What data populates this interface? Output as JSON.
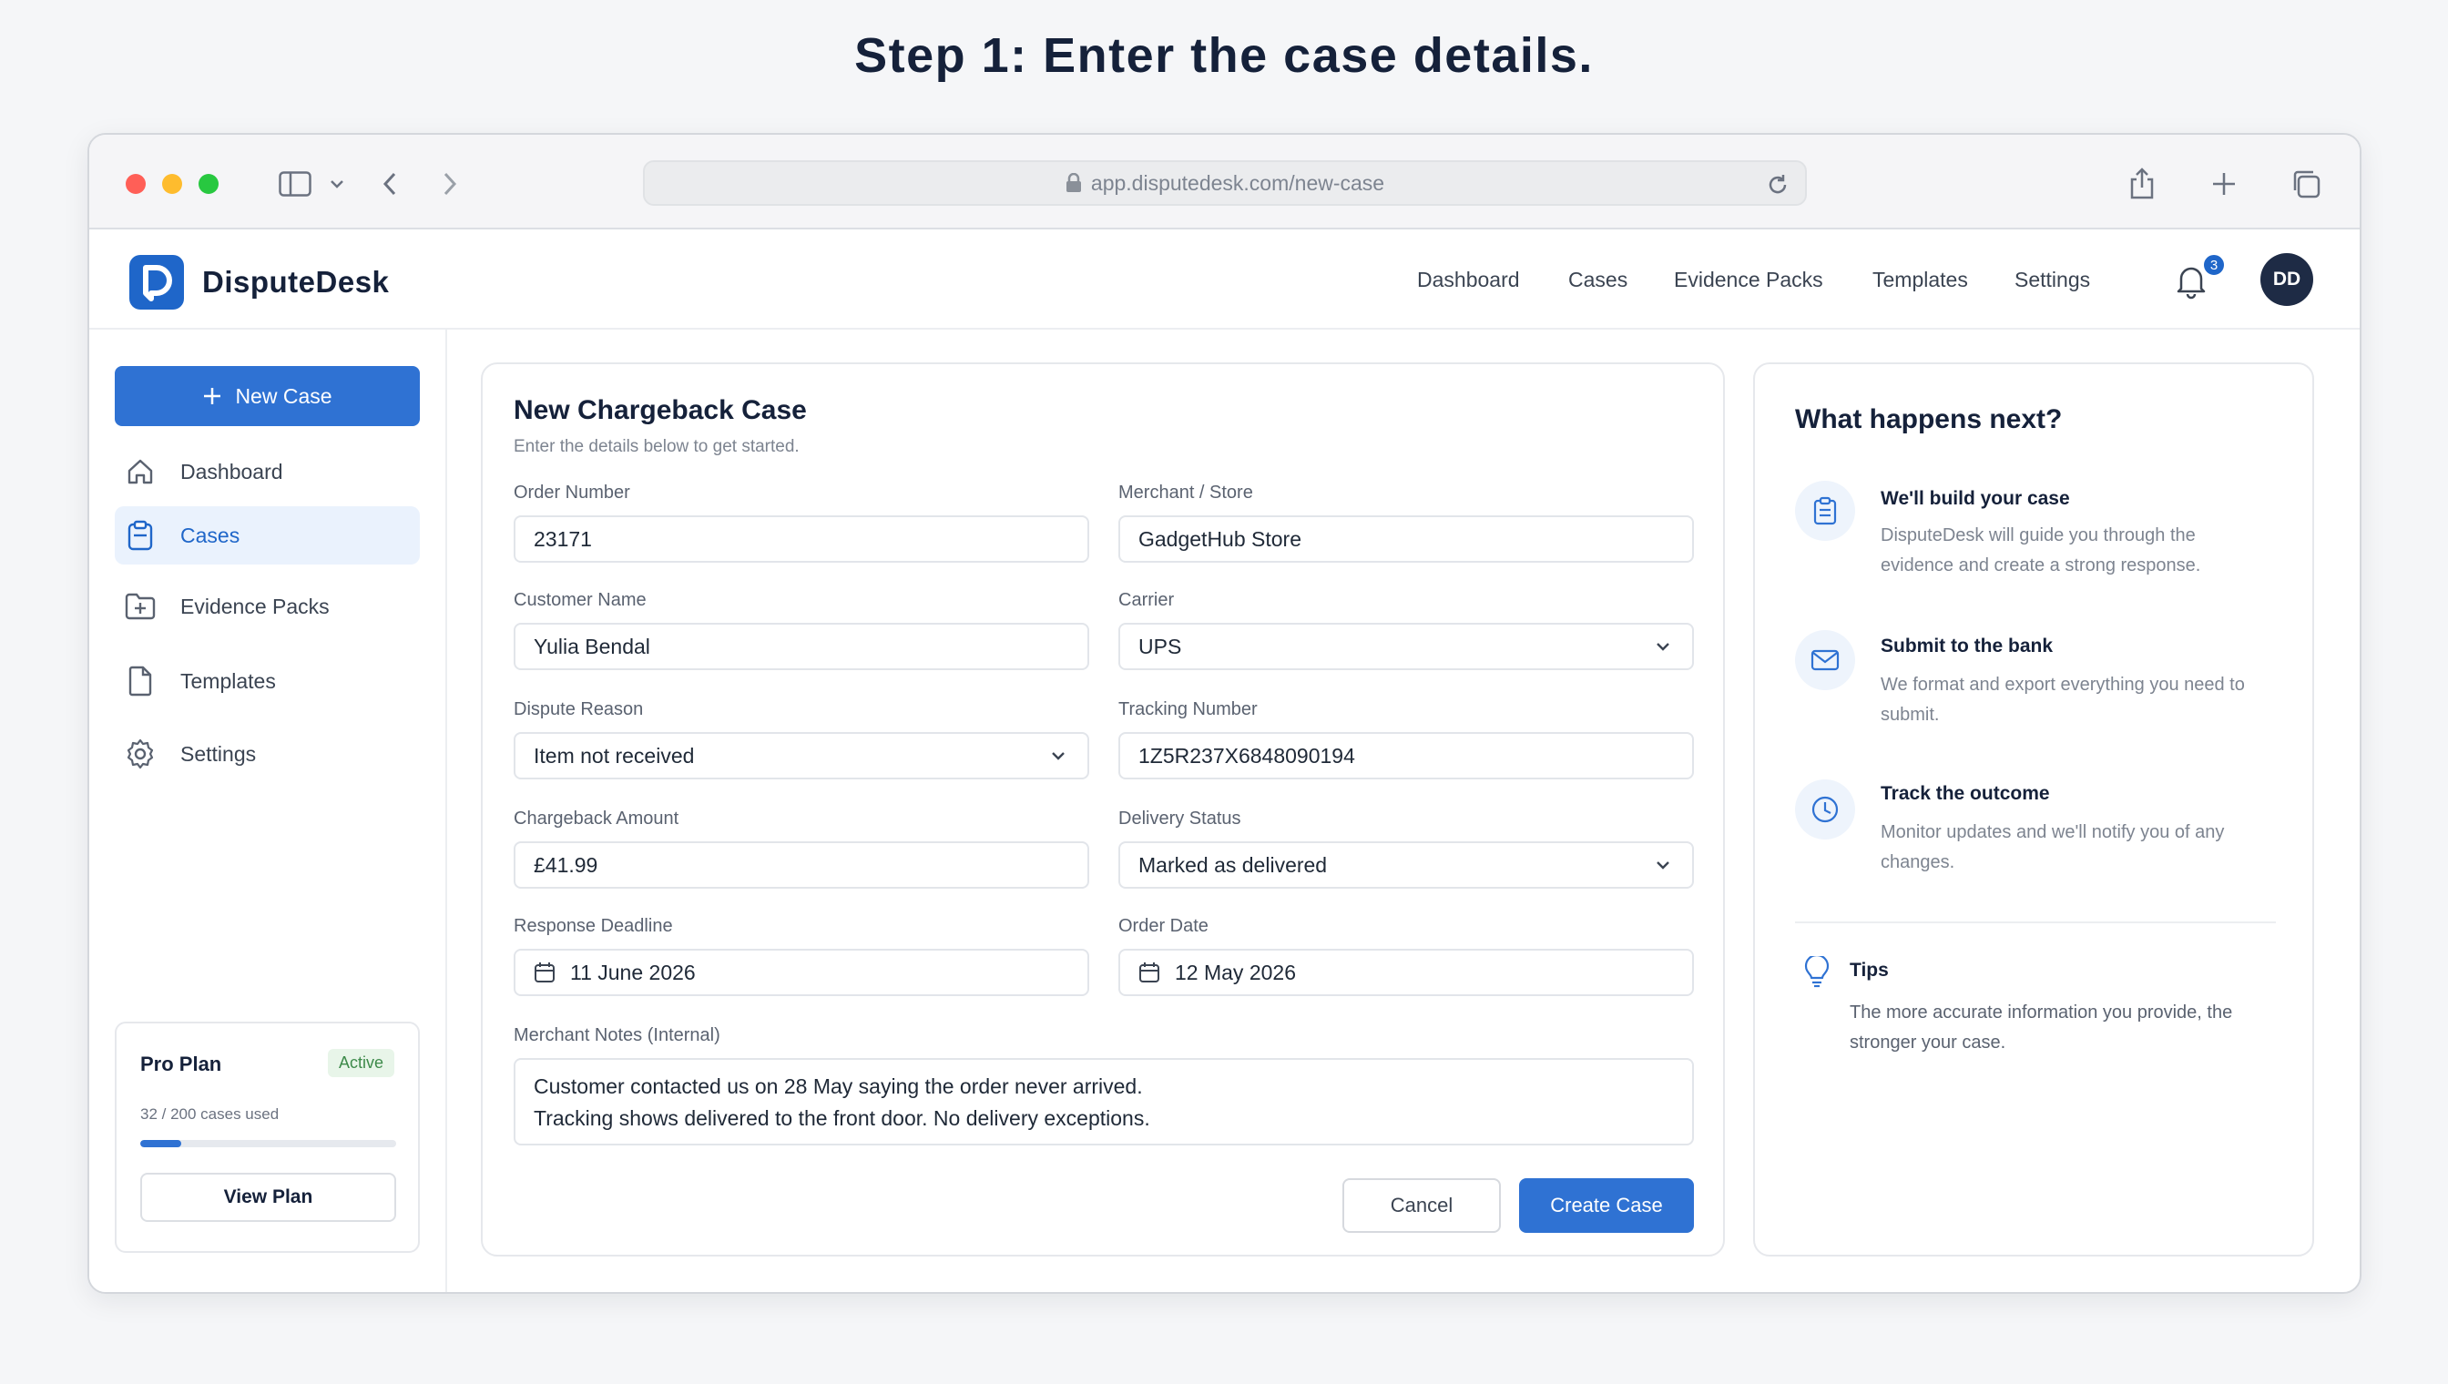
{
  "page": {
    "step_title": "Step 1: Enter the case details."
  },
  "browser": {
    "url": "app.disputedesk.com/new-case"
  },
  "app": {
    "name": "DisputeDesk"
  },
  "header": {
    "nav": [
      "Dashboard",
      "Cases",
      "Evidence Packs",
      "Templates",
      "Settings"
    ],
    "notifications_count": "3",
    "avatar_initials": "DD"
  },
  "sidebar": {
    "new_case_label": "New Case",
    "items": [
      {
        "label": "Dashboard",
        "icon": "home-icon",
        "active": false
      },
      {
        "label": "Cases",
        "icon": "clipboard-icon",
        "active": true
      },
      {
        "label": "Evidence Packs",
        "icon": "folder-plus-icon",
        "active": false
      },
      {
        "label": "Templates",
        "icon": "file-icon",
        "active": false
      },
      {
        "label": "Settings",
        "icon": "gear-icon",
        "active": false
      }
    ],
    "plan": {
      "name": "Pro Plan",
      "status": "Active",
      "usage_text": "32 / 200 cases used",
      "usage_fraction": 0.16,
      "button_label": "View Plan"
    }
  },
  "form": {
    "title": "New Chargeback Case",
    "subtitle": "Enter the details below to get started.",
    "order_number": {
      "label": "Order Number",
      "value": "23171"
    },
    "merchant": {
      "label": "Merchant / Store",
      "value": "GadgetHub Store"
    },
    "customer_name": {
      "label": "Customer Name",
      "value": "Yulia Bendal"
    },
    "carrier": {
      "label": "Carrier",
      "value": "UPS"
    },
    "dispute_reason": {
      "label": "Dispute Reason",
      "value": "Item not received"
    },
    "tracking_number": {
      "label": "Tracking Number",
      "value": "1Z5R237X6848090194"
    },
    "chargeback_amount": {
      "label": "Chargeback Amount",
      "value": "£41.99"
    },
    "delivery_status": {
      "label": "Delivery Status",
      "value": "Marked as delivered"
    },
    "response_deadline": {
      "label": "Response Deadline",
      "value": "11 June 2026"
    },
    "order_date": {
      "label": "Order Date",
      "value": "12 May 2026"
    },
    "notes": {
      "label": "Merchant Notes (Internal)",
      "line1": "Customer contacted us on 28 May saying the order never arrived.",
      "line2": "Tracking shows delivered to the front door. No delivery exceptions."
    },
    "cancel_label": "Cancel",
    "create_label": "Create Case"
  },
  "next": {
    "title": "What happens next?",
    "steps": [
      {
        "title": "We'll build your case",
        "desc": "DisputeDesk will guide you through the evidence and create a strong response.",
        "icon": "clipboard-icon"
      },
      {
        "title": "Submit to the bank",
        "desc": "We format and export everything you need to submit.",
        "icon": "mail-icon"
      },
      {
        "title": "Track the outcome",
        "desc": "Monitor updates and we'll notify you of any changes.",
        "icon": "clock-icon"
      }
    ],
    "tips_title": "Tips",
    "tips_text": "The more accurate information you provide, the stronger your case."
  },
  "colors": {
    "accent": "#2f72d3",
    "brand_dark": "#15213a",
    "active_bg": "#eaf2fd",
    "success": "#3d8a4a"
  }
}
